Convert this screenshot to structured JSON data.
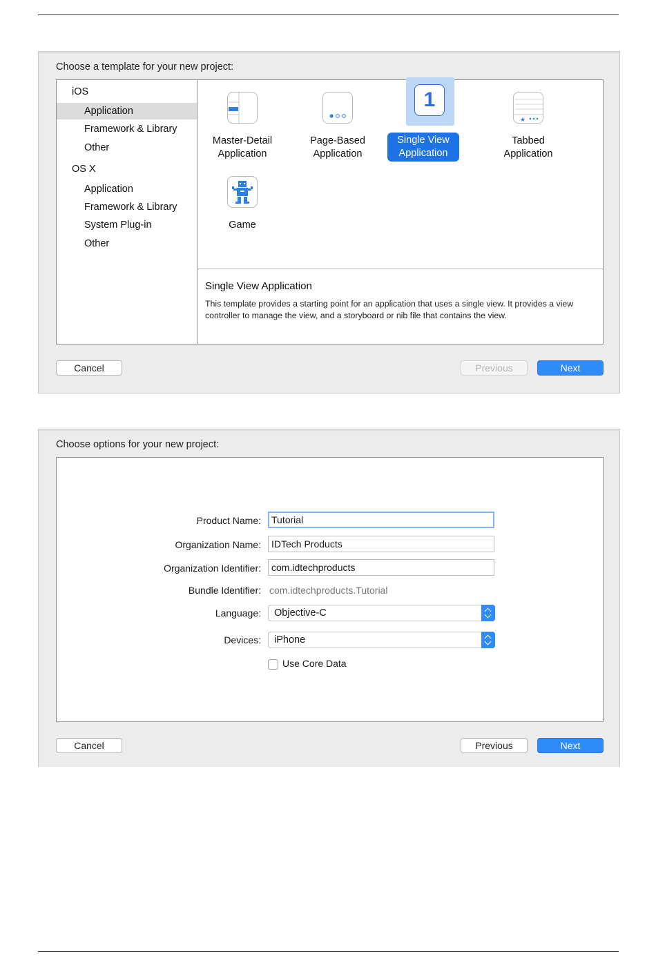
{
  "template_dialog": {
    "title": "Choose a template for your new project:",
    "sidebar": {
      "ios": {
        "label": "iOS",
        "items": [
          "Application",
          "Framework & Library",
          "Other"
        ]
      },
      "osx": {
        "label": "OS X",
        "items": [
          "Application",
          "Framework & Library",
          "System Plug-in",
          "Other"
        ]
      }
    },
    "templates": [
      {
        "line1": "Master-Detail",
        "line2": "Application",
        "icon": "master-detail-icon"
      },
      {
        "line1": "Page-Based",
        "line2": "Application",
        "icon": "page-based-icon"
      },
      {
        "line1": "Single View",
        "line2": "Application",
        "icon": "single-view-icon",
        "icon_glyph": "1"
      },
      {
        "line1": "Tabbed",
        "line2": "Application",
        "icon": "tabbed-icon"
      },
      {
        "line1": "Game",
        "line2": "",
        "icon": "game-icon"
      }
    ],
    "description": {
      "title": "Single View Application",
      "body": "This template provides a starting point for an application that uses a single view. It provides a view controller to manage the view, and a storyboard or nib file that contains the view."
    },
    "buttons": {
      "cancel": "Cancel",
      "previous": "Previous",
      "next": "Next"
    }
  },
  "options_dialog": {
    "title": "Choose options for your new project:",
    "fields": {
      "product_name": {
        "label": "Product Name:",
        "value": "Tutorial"
      },
      "organization_name": {
        "label": "Organization Name:",
        "value": "IDTech Products"
      },
      "organization_identifier": {
        "label": "Organization Identifier:",
        "value": "com.idtechproducts"
      },
      "bundle_identifier": {
        "label": "Bundle Identifier:",
        "value": "com.idtechproducts.Tutorial"
      },
      "language": {
        "label": "Language:",
        "value": "Objective-C"
      },
      "devices": {
        "label": "Devices:",
        "value": "iPhone"
      },
      "core_data": {
        "label": "Use Core Data",
        "checked": false
      }
    },
    "buttons": {
      "cancel": "Cancel",
      "previous": "Previous",
      "next": "Next"
    }
  },
  "colors": {
    "accent": "#2f8bf7",
    "selection": "#1d73e6",
    "selection_bg": "#bcd6f5"
  }
}
